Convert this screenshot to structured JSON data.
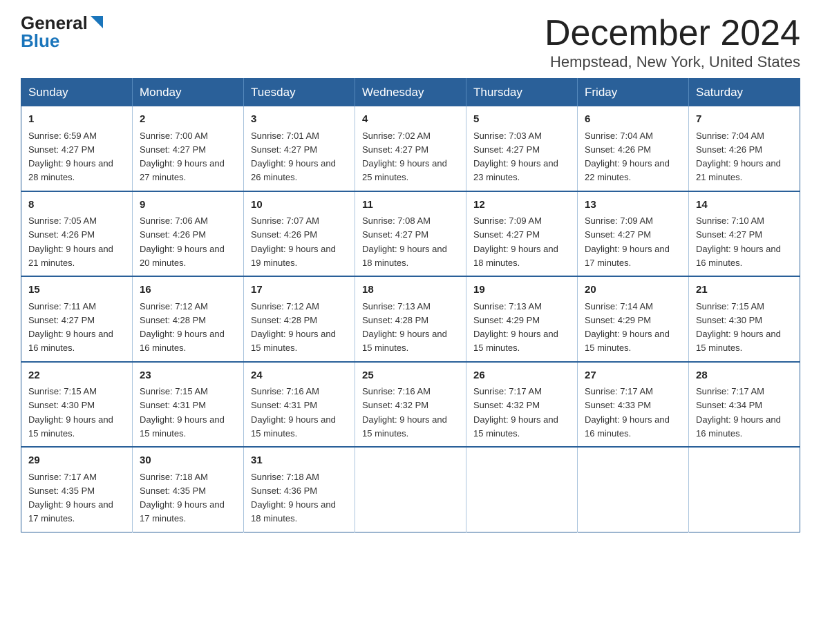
{
  "logo": {
    "general": "General",
    "blue": "Blue"
  },
  "title": "December 2024",
  "location": "Hempstead, New York, United States",
  "days_of_week": [
    "Sunday",
    "Monday",
    "Tuesday",
    "Wednesday",
    "Thursday",
    "Friday",
    "Saturday"
  ],
  "weeks": [
    [
      {
        "day": "1",
        "sunrise": "6:59 AM",
        "sunset": "4:27 PM",
        "daylight": "9 hours and 28 minutes."
      },
      {
        "day": "2",
        "sunrise": "7:00 AM",
        "sunset": "4:27 PM",
        "daylight": "9 hours and 27 minutes."
      },
      {
        "day": "3",
        "sunrise": "7:01 AM",
        "sunset": "4:27 PM",
        "daylight": "9 hours and 26 minutes."
      },
      {
        "day": "4",
        "sunrise": "7:02 AM",
        "sunset": "4:27 PM",
        "daylight": "9 hours and 25 minutes."
      },
      {
        "day": "5",
        "sunrise": "7:03 AM",
        "sunset": "4:27 PM",
        "daylight": "9 hours and 23 minutes."
      },
      {
        "day": "6",
        "sunrise": "7:04 AM",
        "sunset": "4:26 PM",
        "daylight": "9 hours and 22 minutes."
      },
      {
        "day": "7",
        "sunrise": "7:04 AM",
        "sunset": "4:26 PM",
        "daylight": "9 hours and 21 minutes."
      }
    ],
    [
      {
        "day": "8",
        "sunrise": "7:05 AM",
        "sunset": "4:26 PM",
        "daylight": "9 hours and 21 minutes."
      },
      {
        "day": "9",
        "sunrise": "7:06 AM",
        "sunset": "4:26 PM",
        "daylight": "9 hours and 20 minutes."
      },
      {
        "day": "10",
        "sunrise": "7:07 AM",
        "sunset": "4:26 PM",
        "daylight": "9 hours and 19 minutes."
      },
      {
        "day": "11",
        "sunrise": "7:08 AM",
        "sunset": "4:27 PM",
        "daylight": "9 hours and 18 minutes."
      },
      {
        "day": "12",
        "sunrise": "7:09 AM",
        "sunset": "4:27 PM",
        "daylight": "9 hours and 18 minutes."
      },
      {
        "day": "13",
        "sunrise": "7:09 AM",
        "sunset": "4:27 PM",
        "daylight": "9 hours and 17 minutes."
      },
      {
        "day": "14",
        "sunrise": "7:10 AM",
        "sunset": "4:27 PM",
        "daylight": "9 hours and 16 minutes."
      }
    ],
    [
      {
        "day": "15",
        "sunrise": "7:11 AM",
        "sunset": "4:27 PM",
        "daylight": "9 hours and 16 minutes."
      },
      {
        "day": "16",
        "sunrise": "7:12 AM",
        "sunset": "4:28 PM",
        "daylight": "9 hours and 16 minutes."
      },
      {
        "day": "17",
        "sunrise": "7:12 AM",
        "sunset": "4:28 PM",
        "daylight": "9 hours and 15 minutes."
      },
      {
        "day": "18",
        "sunrise": "7:13 AM",
        "sunset": "4:28 PM",
        "daylight": "9 hours and 15 minutes."
      },
      {
        "day": "19",
        "sunrise": "7:13 AM",
        "sunset": "4:29 PM",
        "daylight": "9 hours and 15 minutes."
      },
      {
        "day": "20",
        "sunrise": "7:14 AM",
        "sunset": "4:29 PM",
        "daylight": "9 hours and 15 minutes."
      },
      {
        "day": "21",
        "sunrise": "7:15 AM",
        "sunset": "4:30 PM",
        "daylight": "9 hours and 15 minutes."
      }
    ],
    [
      {
        "day": "22",
        "sunrise": "7:15 AM",
        "sunset": "4:30 PM",
        "daylight": "9 hours and 15 minutes."
      },
      {
        "day": "23",
        "sunrise": "7:15 AM",
        "sunset": "4:31 PM",
        "daylight": "9 hours and 15 minutes."
      },
      {
        "day": "24",
        "sunrise": "7:16 AM",
        "sunset": "4:31 PM",
        "daylight": "9 hours and 15 minutes."
      },
      {
        "day": "25",
        "sunrise": "7:16 AM",
        "sunset": "4:32 PM",
        "daylight": "9 hours and 15 minutes."
      },
      {
        "day": "26",
        "sunrise": "7:17 AM",
        "sunset": "4:32 PM",
        "daylight": "9 hours and 15 minutes."
      },
      {
        "day": "27",
        "sunrise": "7:17 AM",
        "sunset": "4:33 PM",
        "daylight": "9 hours and 16 minutes."
      },
      {
        "day": "28",
        "sunrise": "7:17 AM",
        "sunset": "4:34 PM",
        "daylight": "9 hours and 16 minutes."
      }
    ],
    [
      {
        "day": "29",
        "sunrise": "7:17 AM",
        "sunset": "4:35 PM",
        "daylight": "9 hours and 17 minutes."
      },
      {
        "day": "30",
        "sunrise": "7:18 AM",
        "sunset": "4:35 PM",
        "daylight": "9 hours and 17 minutes."
      },
      {
        "day": "31",
        "sunrise": "7:18 AM",
        "sunset": "4:36 PM",
        "daylight": "9 hours and 18 minutes."
      },
      null,
      null,
      null,
      null
    ]
  ]
}
